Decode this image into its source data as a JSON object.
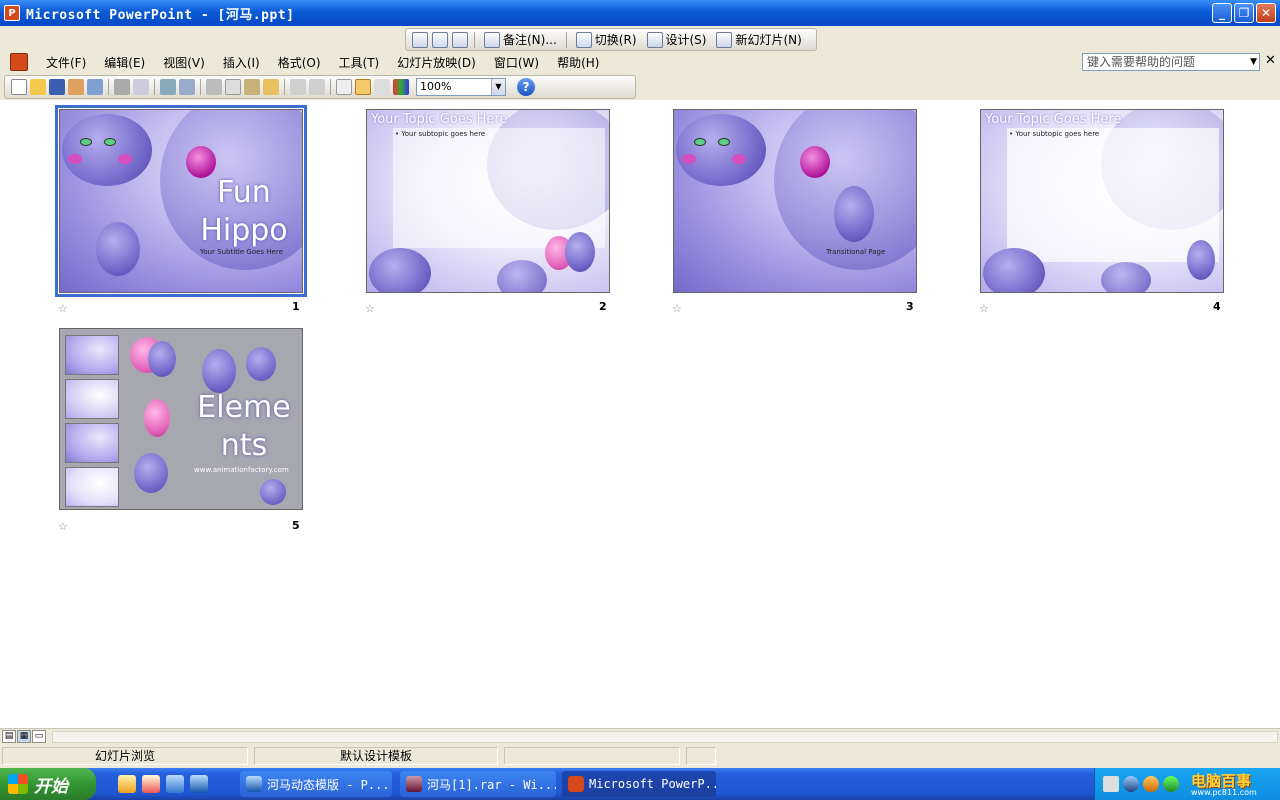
{
  "window": {
    "title": "Microsoft PowerPoint - [河马.ppt]"
  },
  "top_toolbar": {
    "notes": "备注(N)...",
    "transition": "切换(R)",
    "design": "设计(S)",
    "new_slide": "新幻灯片(N)"
  },
  "menu": {
    "items": [
      "文件(F)",
      "编辑(E)",
      "视图(V)",
      "插入(I)",
      "格式(O)",
      "工具(T)",
      "幻灯片放映(D)",
      "窗口(W)",
      "帮助(H)"
    ]
  },
  "help_box": {
    "placeholder": "键入需要帮助的问题"
  },
  "format_toolbar": {
    "zoom": "100%"
  },
  "slides": [
    {
      "number": "1",
      "title": "Fun Hippo",
      "title_line1": "Fun",
      "title_line2": "Hippo",
      "subtitle": "Your Subtitle Goes Here"
    },
    {
      "number": "2",
      "title": "Your Topic Goes Here",
      "bullet": "Your subtopic goes here"
    },
    {
      "number": "3",
      "caption": "Transitional Page"
    },
    {
      "number": "4",
      "title": "Your Topic Goes Here",
      "bullet": "Your subtopic goes here"
    },
    {
      "number": "5",
      "title_line1": "Eleme",
      "title_line2": "nts",
      "url": "www.animationfactory.com"
    }
  ],
  "status": {
    "view": "幻灯片浏览",
    "template": "默认设计模板"
  },
  "taskbar": {
    "start": "开始",
    "tasks": [
      {
        "label": "河马动态模版 - P..."
      },
      {
        "label": "河马[1].rar - Wi..."
      },
      {
        "label": "Microsoft PowerP..."
      }
    ],
    "watermark": "电脑百事",
    "watermark_sub": "www.pc811.com"
  },
  "colors": {
    "title_bar": "#0a5bd6",
    "taskbar": "#245edb",
    "start_button": "#2f8f2f",
    "selection": "#3a6fcf"
  }
}
